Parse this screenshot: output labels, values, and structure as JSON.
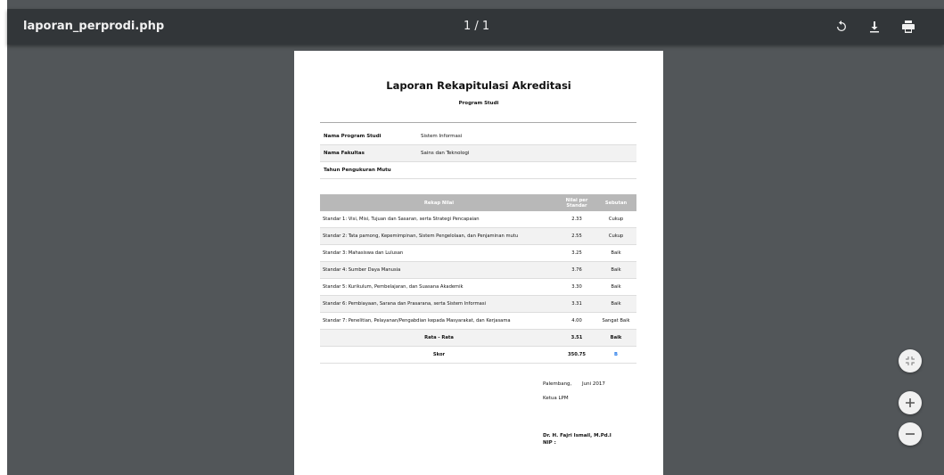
{
  "viewer": {
    "title": "laporan_perprodi.php",
    "page_count": "1 / 1",
    "icons": {
      "rotate": "rotate-icon",
      "download": "download-icon",
      "print": "print-icon",
      "fit": "fit-to-page-icon",
      "zoom_in": "zoom-in-icon",
      "zoom_out": "zoom-out-icon"
    }
  },
  "document": {
    "title": "Laporan Rekapitulasi Akreditasi",
    "subtitle": "Program Studi",
    "info": [
      {
        "label": "Nama Program Studi",
        "value": "Sistem Informasi"
      },
      {
        "label": "Nama Fakultas",
        "value": "Sains dan Teknologi"
      },
      {
        "label": "Tahun Pengukuran Mutu",
        "value": ""
      }
    ],
    "table": {
      "headers": {
        "rekap": "Rekap Nilai",
        "nilai_line1": "Nilai per",
        "nilai_line2": "Standar",
        "sebutan": "Sebutan"
      },
      "rows": [
        {
          "standar": "Standar 1: Visi, Misi, Tujuan dan Sasaran, serta Strategi Pencapaian",
          "nilai": "2.33",
          "sebutan": "Cukup"
        },
        {
          "standar": "Standar 2: Tata pamong, Kepemimpinan, Sistem Pengelolaan, dan Penjaminan mutu",
          "nilai": "2.55",
          "sebutan": "Cukup"
        },
        {
          "standar": "Standar 3: Mahasiswa dan Lulusan",
          "nilai": "3.25",
          "sebutan": "Baik"
        },
        {
          "standar": "Standar 4: Sumber Daya Manusia",
          "nilai": "3.76",
          "sebutan": "Baik"
        },
        {
          "standar": "Standar 5: Kurikulum, Pembelajaran, dan Suasana Akademik",
          "nilai": "3.30",
          "sebutan": "Baik"
        },
        {
          "standar": "Standar 6: Pembiayaan, Sarana dan Prasarana, serta Sistem Informasi",
          "nilai": "3.31",
          "sebutan": "Baik"
        },
        {
          "standar": "Standar 7: Penelitian, Pelayanan/Pengabdian kepada Masyarakat, dan Kerjasama",
          "nilai": "4.00",
          "sebutan": "Sangat Baik"
        }
      ],
      "rata": {
        "label": "Rata - Rata",
        "nilai": "3.51",
        "sebutan": "Baik"
      },
      "skor": {
        "label": "Skor",
        "nilai": "350.75",
        "sebutan": "B"
      }
    },
    "signature": {
      "place_date": "Palembang,",
      "month_year": "Juni 2017",
      "role": "Ketua LPM",
      "name": "Dr. H. Fajri Ismail, M.Pd.I",
      "nip": "NIP :"
    }
  },
  "colors": {
    "toolbar": "#323639",
    "background": "#525659",
    "table_header": "#b8b8b8",
    "grade_accent": "#1a73e8"
  }
}
